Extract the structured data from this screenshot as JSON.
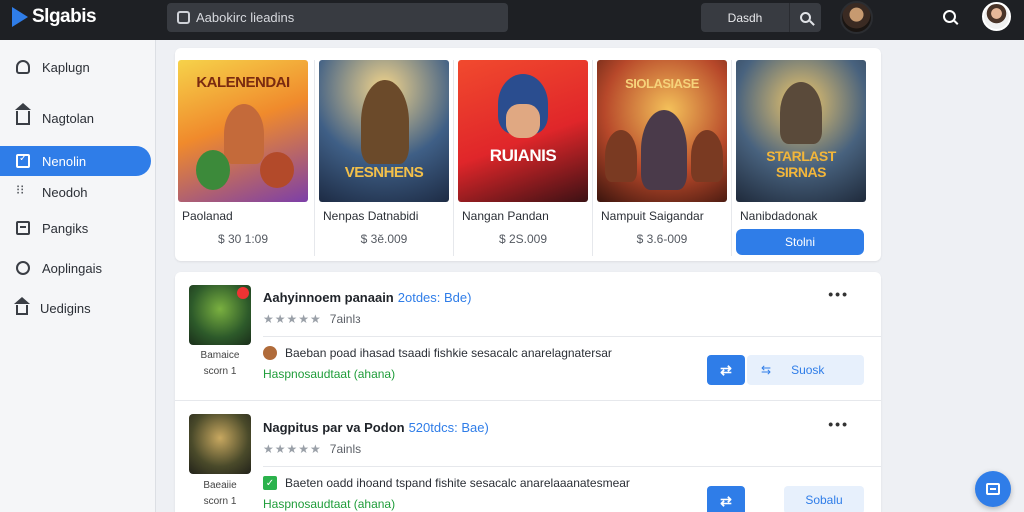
{
  "app": {
    "name": "Slgabis"
  },
  "search": {
    "placeholder": "Aabokirc lieadins",
    "button_label": "Dasdh"
  },
  "sidebar": {
    "items": [
      {
        "label": "Kaplugn",
        "icon": "person-icon",
        "active": false
      },
      {
        "label": "Nagtolan",
        "icon": "home-icon",
        "active": false
      },
      {
        "label": "Nenolin",
        "icon": "checkbox-icon",
        "active": true
      },
      {
        "label": "Neodoh",
        "icon": "dots-icon",
        "active": false
      },
      {
        "label": "Pangiks",
        "icon": "calendar-icon",
        "active": false
      },
      {
        "label": "Aoplingais",
        "icon": "gear-icon",
        "active": false
      },
      {
        "label": "Uedigins",
        "icon": "house-icon",
        "active": false
      }
    ]
  },
  "cards": [
    {
      "art_title": "KALENENDAI",
      "name": "Paolanad",
      "price": "$ 30 1:09"
    },
    {
      "art_title": "VESNHENS",
      "name": "Nenpas Datnabidi",
      "price": "$ 3ĕ.009"
    },
    {
      "art_title": "RUIANIS",
      "name": "Nangan Pandan",
      "price": "$ 2S.009"
    },
    {
      "art_title": "SIOLASIASE",
      "name": "Nampuit Saigandar",
      "price": "$ 3.6-009"
    },
    {
      "art_title": "STARLAST SIRNAS",
      "name": "Nanibdadonak",
      "button_label": "Stolni"
    }
  ],
  "feed": [
    {
      "title": "Aahyinnoem panaain",
      "tag": "2otdes: Bde)",
      "rating_count": "7ainlз",
      "caption_line1": "Bamaice",
      "caption_line2": "scorn 1",
      "description": "Baeban poad ihasad tsaadi fishkie sesacalc anarelagnatersar",
      "status": "Haspnosaudtaat (ahana)",
      "subscribe_label": "Suosk"
    },
    {
      "title": "Nagpitus par va Podon",
      "tag": "520tdcs: Bae)",
      "rating_count": "7ainls",
      "caption_line1": "Baeaiie",
      "caption_line2": "scorn 1",
      "description": "Baeten oadd ihoand tspand fishite sesacalc anarelaaanatesmear",
      "status": "Haspnosaudtaat (ahana)",
      "subscribe_label": "Sobalu"
    }
  ],
  "colors": {
    "accent": "#2f7de8",
    "topbar": "#1e2024",
    "success": "#1f9d3a"
  }
}
